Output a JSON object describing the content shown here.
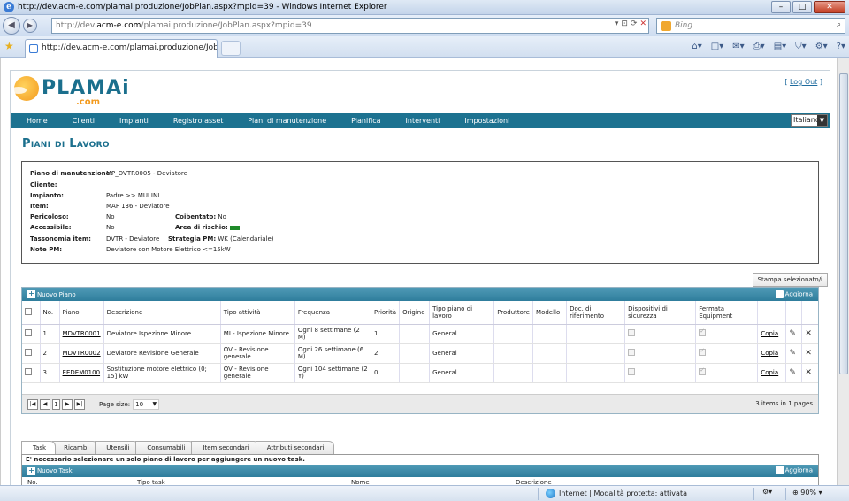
{
  "browser": {
    "window_title": "http://dev.acm-e.com/plamai.produzione/JobPlan.aspx?mpid=39 - Windows Internet Explorer",
    "url_prefix": "http://dev.",
    "url_domain": "acm-e.com",
    "url_rest": "/plamai.produzione/JobPlan.aspx?mpid=39",
    "search_placeholder": "Bing",
    "tab_title": "http://dev.acm-e.com/plamai.produzione/JobPl...",
    "status_zone": "Internet | Modalità protetta: attivata",
    "zoom": "90%"
  },
  "app": {
    "logo_text": "PLAMAi",
    "logo_sub": ".com",
    "logout": "Log Out",
    "menu": [
      "Home",
      "Clienti",
      "Impianti",
      "Registro asset",
      "Piani di manutenzione",
      "Pianifica",
      "Interventi",
      "Impostazioni"
    ],
    "language": "Italiano",
    "page_title": "Piani di Lavoro"
  },
  "info": {
    "piano_label": "Piano di manutenzione:",
    "piano_value": "MP_DVTR0005 - Deviatore",
    "cliente_label": "Cliente:",
    "cliente_value": "",
    "impianto_label": "Impianto:",
    "impianto_value": "Padre >> MULINI",
    "item_label": "Item:",
    "item_value": "MAF 136 - Deviatore",
    "pericoloso_label": "Pericoloso:",
    "pericoloso_value": "No",
    "coibentato_label": "Coibentato:",
    "coibentato_value": "No",
    "accessibile_label": "Accessibile:",
    "accessibile_value": "No",
    "rischio_label": "Area di rischio:",
    "rischio_color": "#1f8a2a",
    "tassonomia_label": "Tassonomia item:",
    "tassonomia_value": "DVTR - Deviatore",
    "strategia_label": "Strategia PM:",
    "strategia_value": "WK (Calendariale)",
    "note_label": "Note PM:",
    "note_value": "Deviatore con Motore Elettrico <=15kW"
  },
  "print_button": "Stampa selezionato/i",
  "grid": {
    "add_label": "Nuovo Piano",
    "refresh_label": "Aggiorna",
    "columns": [
      "No.",
      "Piano",
      "Descrizione",
      "Tipo attività",
      "Frequenza",
      "Priorità",
      "Origine",
      "Tipo piano di lavoro",
      "Produttore",
      "Modello",
      "Doc. di riferimento",
      "Dispositivi di sicurezza",
      "Fermata Equipment"
    ],
    "copy_label": "Copia",
    "rows": [
      {
        "no": "1",
        "piano": "MDVTR0001",
        "descrizione": "Deviatore Ispezione Minore",
        "tipo": "MI - Ispezione Minore",
        "frequenza": "Ogni 8 settimane (2 M)",
        "priorita": "1",
        "origine": "",
        "tipo_piano": "General",
        "produttore": "",
        "modello": "",
        "doc": ""
      },
      {
        "no": "2",
        "piano": "MDVTR0002",
        "descrizione": "Deviatore Revisione Generale",
        "tipo": "OV - Revisione generale",
        "frequenza": "Ogni 26 settimane (6 M)",
        "priorita": "2",
        "origine": "",
        "tipo_piano": "General",
        "produttore": "",
        "modello": "",
        "doc": ""
      },
      {
        "no": "3",
        "piano": "EEDEM0100",
        "descrizione": "Sostituzione motore elettrico (0; 15] kW",
        "tipo": "OV - Revisione generale",
        "frequenza": "Ogni 104 settimane (2 Y)",
        "priorita": "0",
        "origine": "",
        "tipo_piano": "General",
        "produttore": "",
        "modello": "",
        "doc": ""
      }
    ],
    "pager_page": "1",
    "page_size_label": "Page size:",
    "page_size": "10",
    "items_info": "3 items in 1 pages"
  },
  "tabs": [
    "Task",
    "Ricambi",
    "Utensili",
    "Consumabili",
    "Item secondari",
    "Attributi secondari"
  ],
  "task_panel": {
    "message": "E' necessario selezionare un solo piano di lavoro per aggiungere un nuovo task.",
    "add_label": "Nuovo Task",
    "refresh_label": "Aggiorna",
    "columns": [
      "No.",
      "Tipo task",
      "Nome",
      "Descrizione"
    ]
  }
}
